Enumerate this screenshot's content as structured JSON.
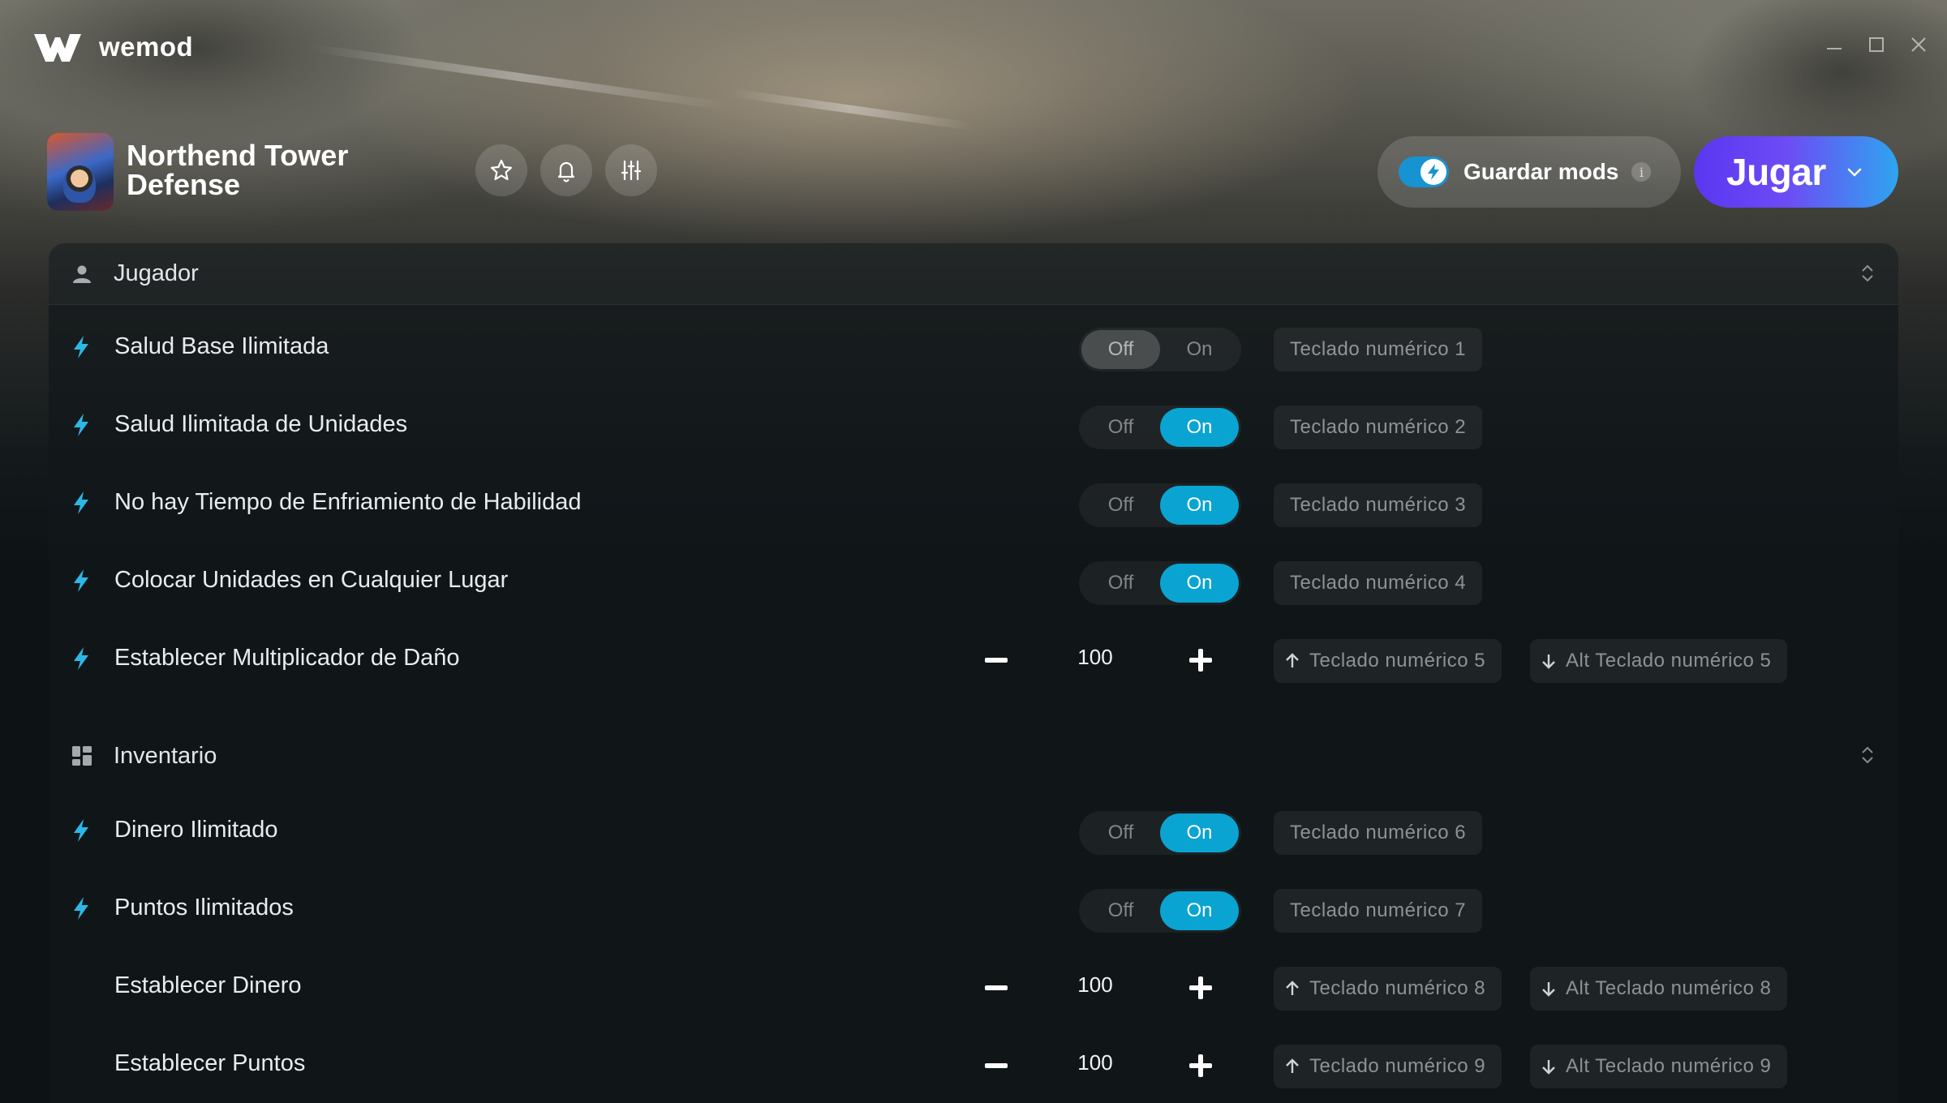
{
  "app": {
    "brand": "wemod"
  },
  "game": {
    "title": "Northend Tower Defense"
  },
  "header": {
    "save_mods_label": "Guardar mods",
    "save_mods_enabled": true,
    "info_label": "i",
    "play_label": "Jugar"
  },
  "colors": {
    "accent_on": "#0aa4d2",
    "play_gradient_start": "#5a37f0",
    "play_gradient_end": "#2ea5f0",
    "bolt": "#2cb8e6"
  },
  "sections": [
    {
      "title": "Jugador",
      "icon": "user-icon",
      "rows": [
        {
          "label": "Salud Base Ilimitada",
          "type": "toggle",
          "off": "Off",
          "on": "On",
          "state": "off",
          "keys": [
            "Teclado numérico 1"
          ]
        },
        {
          "label": "Salud Ilimitada de Unidades",
          "type": "toggle",
          "off": "Off",
          "on": "On",
          "state": "on",
          "keys": [
            "Teclado numérico 2"
          ]
        },
        {
          "label": "No hay Tiempo de Enfriamiento de Habilidad",
          "type": "toggle",
          "off": "Off",
          "on": "On",
          "state": "on",
          "keys": [
            "Teclado numérico 3"
          ]
        },
        {
          "label": "Colocar Unidades en Cualquier Lugar",
          "type": "toggle",
          "off": "Off",
          "on": "On",
          "state": "on",
          "keys": [
            "Teclado numérico 4"
          ]
        },
        {
          "label": "Establecer Multiplicador de Daño",
          "type": "stepper",
          "value": "100",
          "keys": [
            "Teclado numérico 5",
            "Alt Teclado numérico 5"
          ]
        }
      ]
    },
    {
      "title": "Inventario",
      "icon": "grid-icon",
      "rows": [
        {
          "label": "Dinero Ilimitado",
          "type": "toggle",
          "off": "Off",
          "on": "On",
          "state": "on",
          "keys": [
            "Teclado numérico 6"
          ]
        },
        {
          "label": "Puntos Ilimitados",
          "type": "toggle",
          "off": "Off",
          "on": "On",
          "state": "on",
          "keys": [
            "Teclado numérico 7"
          ]
        },
        {
          "label": "Establecer Dinero",
          "type": "stepper",
          "value": "100",
          "keys": [
            "Teclado numérico 8",
            "Alt Teclado numérico 8"
          ]
        },
        {
          "label": "Establecer Puntos",
          "type": "stepper",
          "value": "100",
          "keys": [
            "Teclado numérico 9",
            "Alt Teclado numérico 9"
          ]
        }
      ]
    }
  ]
}
